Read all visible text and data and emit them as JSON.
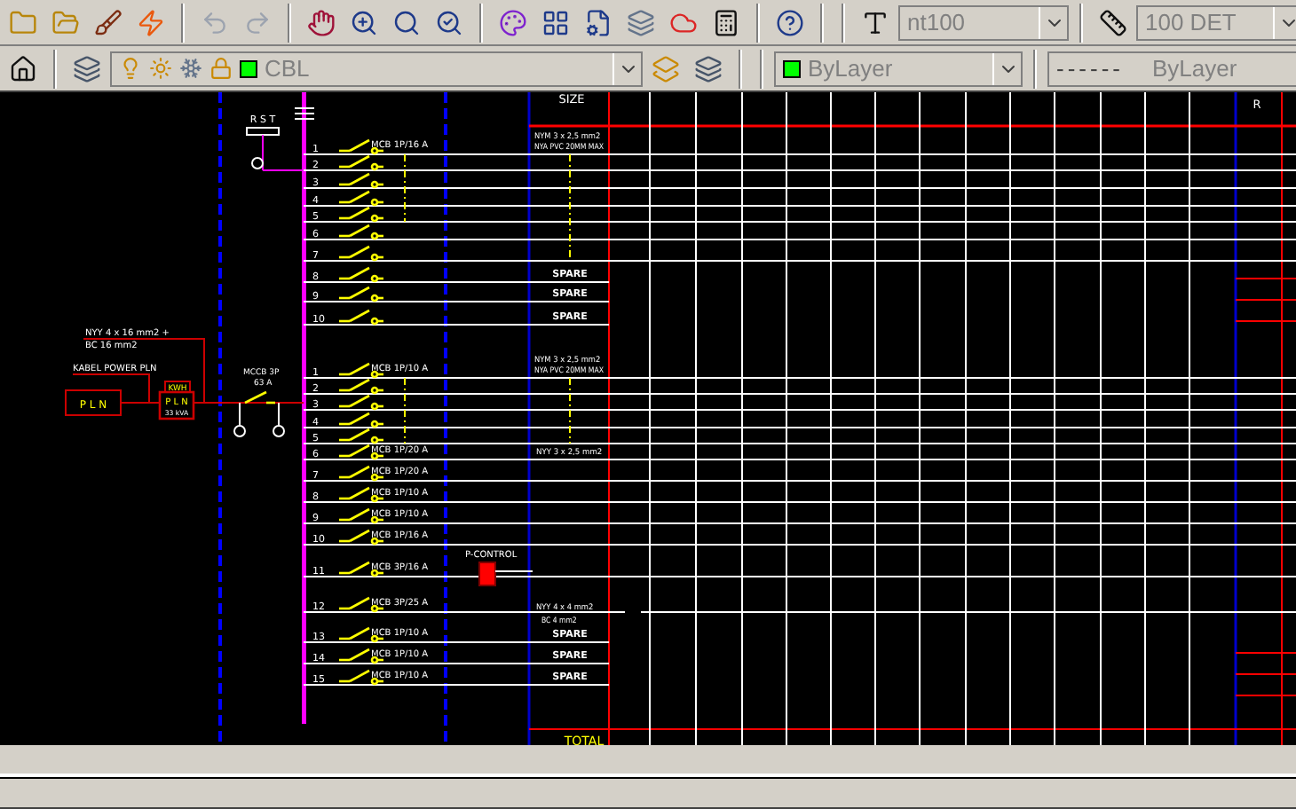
{
  "toolbar_top": {
    "text_style": "nt100",
    "dim_style": "100 DET"
  },
  "toolbar_layers": {
    "layer": {
      "name": "CBL",
      "color": "#00ff00"
    },
    "color_control": {
      "value": "ByLayer",
      "color": "#00ff00"
    },
    "linetype_control": {
      "pattern": "------",
      "value": "ByLayer"
    }
  },
  "drawing": {
    "headers": {
      "size": "SIZE",
      "column_r": "R"
    },
    "phases": "R S T",
    "supply": {
      "source": "P L N",
      "meter_label": "KWH",
      "meter": "P L N",
      "meter_rating": "33 kVA",
      "feeder": "KABEL POWER PLN",
      "cable": "NYY 4 x 16 mm2 +",
      "cable_2": "BC 16 mm2",
      "main_breaker": "MCCB 3P",
      "main_rating": "63 A"
    },
    "groups": [
      {
        "cable": "NYM 3 x 2,5 mm2",
        "cable_2": "NYA PVC 20MM MAX",
        "circuits": [
          {
            "number": "1",
            "breaker": "MCB 1P/16 A"
          },
          {
            "number": "2"
          },
          {
            "number": "3"
          },
          {
            "number": "4"
          },
          {
            "number": "5"
          },
          {
            "number": "6"
          },
          {
            "number": "7"
          },
          {
            "number": "8",
            "load": "SPARE"
          },
          {
            "number": "9",
            "load": "SPARE"
          },
          {
            "number": "10",
            "load": "SPARE"
          }
        ]
      },
      {
        "cable": "NYM 3 x 2,5 mm2",
        "cable_2": "NYA PVC 20MM MAX",
        "circuits": [
          {
            "number": "1",
            "breaker": "MCB 1P/10 A"
          },
          {
            "number": "2"
          },
          {
            "number": "3"
          },
          {
            "number": "4"
          },
          {
            "number": "5"
          },
          {
            "number": "6",
            "breaker": "MCB 1P/20 A",
            "cable": "NYY 3 x 2,5 mm2"
          },
          {
            "number": "7",
            "breaker": "MCB 1P/20 A"
          },
          {
            "number": "8",
            "breaker": "MCB 1P/10 A"
          },
          {
            "number": "9",
            "breaker": "MCB 1P/10 A"
          },
          {
            "number": "10",
            "breaker": "MCB 1P/16 A"
          },
          {
            "number": "11",
            "breaker": "MCB 3P/16 A",
            "control": "P-CONTROL"
          },
          {
            "number": "12",
            "breaker": "MCB 3P/25 A",
            "cable": "NYY 4 x 4 mm2",
            "cable_2": "BC 4 mm2"
          },
          {
            "number": "13",
            "breaker": "MCB 1P/10 A",
            "load": "SPARE"
          },
          {
            "number": "14",
            "breaker": "MCB 1P/10 A",
            "load": "SPARE"
          },
          {
            "number": "15",
            "breaker": "MCB 1P/10 A",
            "load": "SPARE"
          }
        ]
      }
    ],
    "total": "TOTAL"
  }
}
